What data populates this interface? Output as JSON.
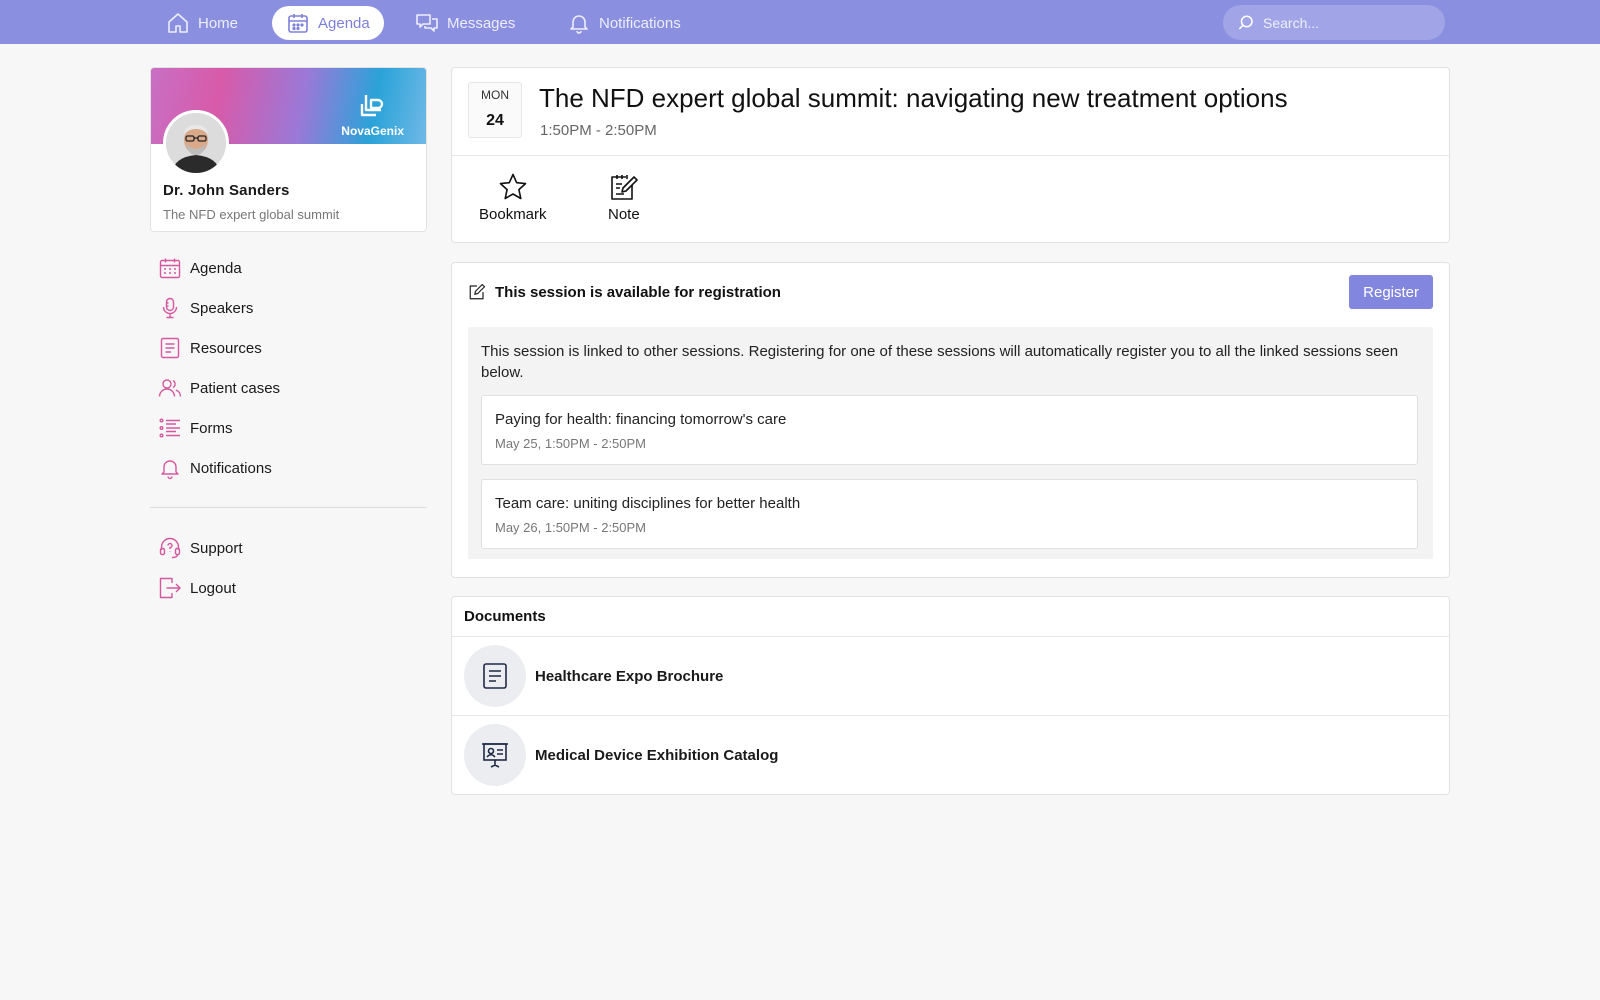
{
  "topnav": {
    "items": [
      {
        "label": "Home",
        "icon": "home-icon"
      },
      {
        "label": "Agenda",
        "icon": "calendar-icon",
        "active": true
      },
      {
        "label": "Messages",
        "icon": "messages-icon"
      },
      {
        "label": "Notifications",
        "icon": "bell-icon"
      }
    ],
    "search_placeholder": "Search..."
  },
  "profile": {
    "brand": "NovaGenix",
    "name": "Dr. John Sanders",
    "subtitle": "The NFD expert global summit"
  },
  "sidebar": {
    "items": [
      {
        "label": "Agenda",
        "icon": "calendar-icon"
      },
      {
        "label": "Speakers",
        "icon": "microphone-icon"
      },
      {
        "label": "Resources",
        "icon": "document-icon"
      },
      {
        "label": "Patient cases",
        "icon": "users-icon"
      },
      {
        "label": "Forms",
        "icon": "list-icon"
      },
      {
        "label": "Notifications",
        "icon": "bell-icon"
      }
    ],
    "secondary": [
      {
        "label": "Support",
        "icon": "headset-icon"
      },
      {
        "label": "Logout",
        "icon": "logout-icon"
      }
    ]
  },
  "session": {
    "dow": "MON",
    "day": "24",
    "title": "The NFD expert global summit: navigating new treatment options",
    "time": "1:50PM - 2:50PM",
    "actions": {
      "bookmark": "Bookmark",
      "note": "Note"
    }
  },
  "registration": {
    "heading": "This session is available for registration",
    "button": "Register",
    "description": "This session is linked to other sessions. Registering for one of these sessions will automatically register you to all the linked sessions seen below.",
    "linked": [
      {
        "title": "Paying for health: financing tomorrow's care",
        "time": "May 25, 1:50PM - 2:50PM"
      },
      {
        "title": "Team care: uniting disciplines for better health",
        "time": "May 26, 1:50PM - 2:50PM"
      }
    ]
  },
  "documents": {
    "title": "Documents",
    "items": [
      {
        "name": "Healthcare Expo Brochure",
        "icon": "document-icon"
      },
      {
        "name": "Medical Device Exhibition Catalog",
        "icon": "presentation-icon"
      }
    ]
  },
  "colors": {
    "accent": "#8b8fdf",
    "button": "#8386de",
    "sidebar_icon": "#d6589f"
  }
}
